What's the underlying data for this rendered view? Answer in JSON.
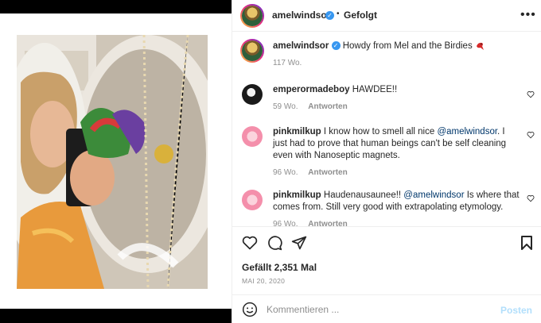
{
  "post": {
    "username": "amelwindsor",
    "follow_status": "Gefolgt",
    "caption": "Howdy from Mel and the Birdies",
    "caption_emoji": "parrot-icon",
    "caption_age": "117 Wo."
  },
  "comments": [
    {
      "username": "emperormadeboy",
      "text": "HAWDEE!!",
      "age": "59 Wo.",
      "reply_label": "Antworten"
    },
    {
      "username": "pinkmilkup",
      "text_before": "I know how to smell all nice ",
      "mention": "@amelwindsor",
      "text_after": ". I just had to prove that human beings can't be self cleaning even with Nanoseptic magnets.",
      "age": "96 Wo.",
      "reply_label": "Antworten"
    },
    {
      "username": "pinkmilkup",
      "text_before": "Haudenausaunee!! ",
      "mention": "@amelwindsor",
      "text_after": " Is where that comes from. Still very good with extrapolating etymology.",
      "age": "96 Wo.",
      "reply_label": "Antworten"
    }
  ],
  "actions": {
    "likes_text": "Gefällt 2,351 Mal",
    "date": "MAI 20, 2020"
  },
  "compose": {
    "placeholder": "Kommentieren ...",
    "post_label": "Posten"
  },
  "colors": {
    "link": "#00376b",
    "verified": "#3897f0",
    "muted": "#8e8e8e",
    "post_disabled": "#b2dffc"
  }
}
